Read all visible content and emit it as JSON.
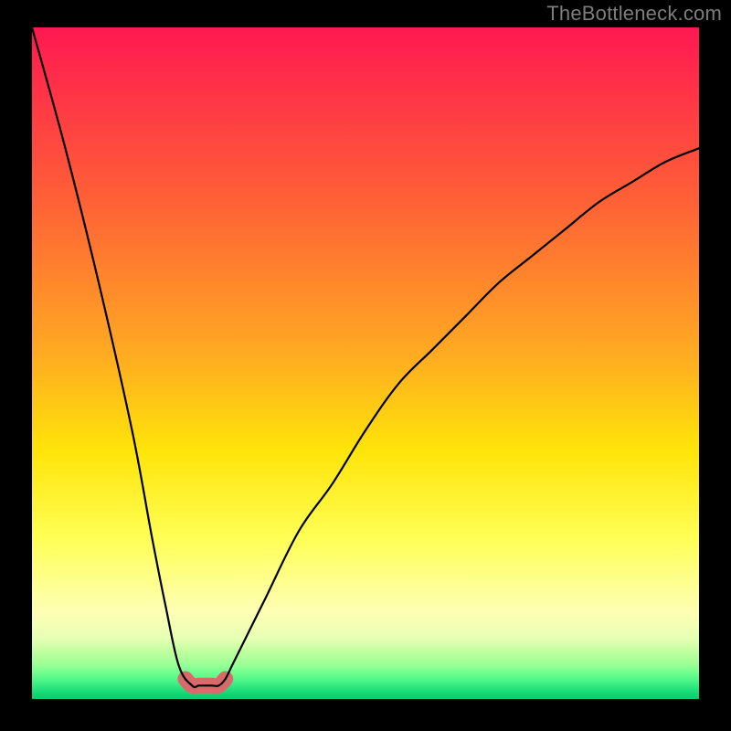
{
  "watermark": "TheBottleneck.com",
  "chart_data": {
    "type": "line",
    "title": "",
    "xlabel": "",
    "ylabel": "",
    "xlim": [
      0,
      100
    ],
    "ylim": [
      0,
      100
    ],
    "series": [
      {
        "name": "bottleneck-curve",
        "x": [
          0,
          5,
          10,
          15,
          18,
          20,
          22,
          24,
          25,
          26,
          27,
          28,
          29,
          30,
          32,
          35,
          40,
          45,
          50,
          55,
          60,
          65,
          70,
          75,
          80,
          85,
          90,
          95,
          100
        ],
        "values": [
          100,
          82,
          62,
          40,
          24,
          14,
          5,
          2,
          2,
          2,
          2,
          2,
          3,
          5,
          9,
          15,
          25,
          32,
          40,
          47,
          52,
          57,
          62,
          66,
          70,
          74,
          77,
          80,
          82
        ]
      },
      {
        "name": "highlight-band",
        "x": [
          23,
          24,
          25,
          26,
          27,
          28,
          29
        ],
        "values": [
          3,
          2,
          2,
          2,
          2,
          2,
          3
        ]
      }
    ],
    "colors": {
      "curve": "#000000",
      "highlight": "#d86a6b"
    },
    "gradient_stops": [
      {
        "pos": 0,
        "color": "#ff1851"
      },
      {
        "pos": 0.26,
        "color": "#ff6136"
      },
      {
        "pos": 0.48,
        "color": "#ffa822"
      },
      {
        "pos": 0.63,
        "color": "#ffe409"
      },
      {
        "pos": 0.76,
        "color": "#ffff55"
      },
      {
        "pos": 0.87,
        "color": "#feffb4"
      },
      {
        "pos": 0.91,
        "color": "#e6ffb4"
      },
      {
        "pos": 0.93,
        "color": "#bfff9e"
      },
      {
        "pos": 0.948,
        "color": "#9cff97"
      },
      {
        "pos": 0.96,
        "color": "#74ff8f"
      },
      {
        "pos": 0.972,
        "color": "#4cf788"
      },
      {
        "pos": 0.984,
        "color": "#28e37d"
      },
      {
        "pos": 0.992,
        "color": "#12d674"
      },
      {
        "pos": 1.0,
        "color": "#07cf70"
      }
    ]
  }
}
